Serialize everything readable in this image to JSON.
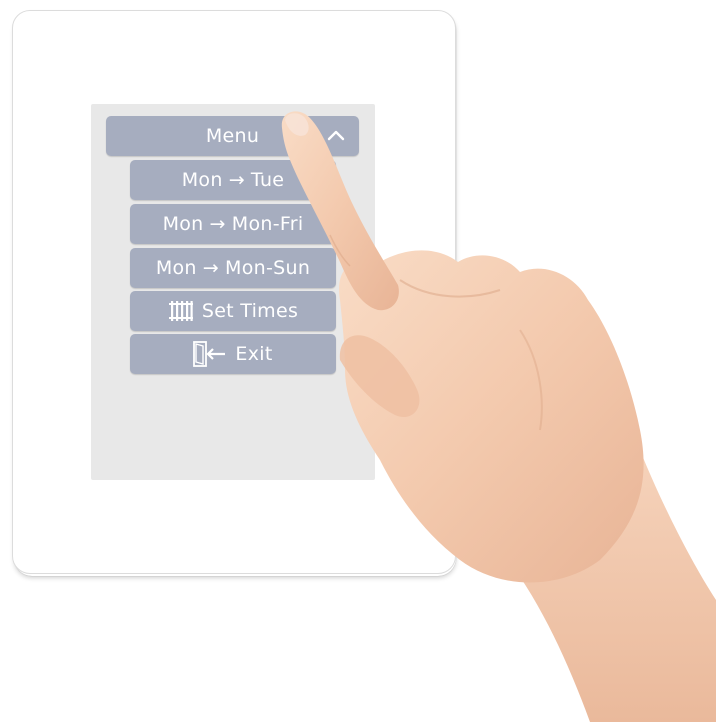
{
  "menu": {
    "header_label": "Menu",
    "header_icon": "chevron-up-icon",
    "items": [
      {
        "from": "Mon",
        "arrow": "→",
        "to": "Tue"
      },
      {
        "from": "Mon",
        "arrow": "→",
        "to": "Mon-Fri"
      },
      {
        "from": "Mon",
        "arrow": "→",
        "to": "Mon-Sun"
      },
      {
        "icon": "radiator-icon",
        "label": "Set Times"
      },
      {
        "icon": "exit-door-icon",
        "label": "Exit"
      }
    ]
  },
  "colors": {
    "button_bg": "#a6adbf",
    "screen_bg": "#e8e8e8",
    "text": "#ffffff"
  }
}
